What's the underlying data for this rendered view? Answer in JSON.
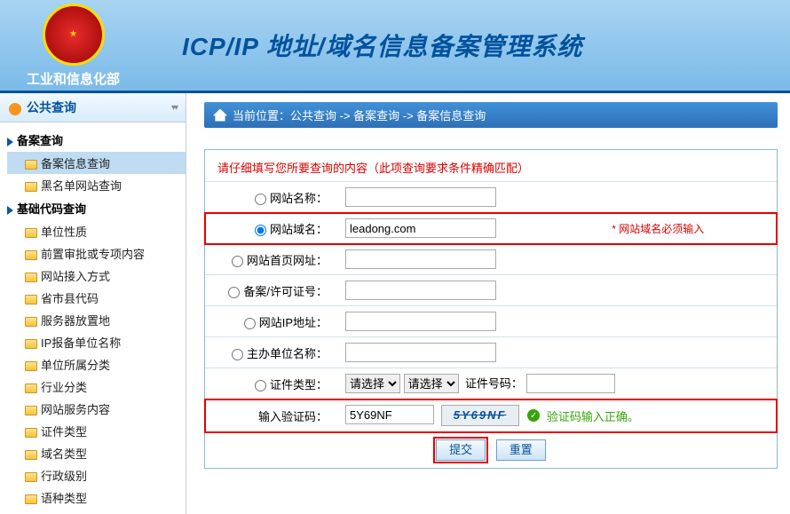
{
  "header": {
    "ministry": "工业和信息化部",
    "system_title": "ICP/IP 地址/域名信息备案管理系统"
  },
  "sidebar": {
    "header": "公共查询",
    "groups": [
      {
        "label": "备案查询",
        "items": [
          {
            "label": "备案信息查询",
            "selected": true
          },
          {
            "label": "黑名单网站查询",
            "selected": false
          }
        ]
      },
      {
        "label": "基础代码查询",
        "items": [
          {
            "label": "单位性质"
          },
          {
            "label": "前置审批或专项内容"
          },
          {
            "label": "网站接入方式"
          },
          {
            "label": "省市县代码"
          },
          {
            "label": "服务器放置地"
          },
          {
            "label": "IP报备单位名称"
          },
          {
            "label": "单位所属分类"
          },
          {
            "label": "行业分类"
          },
          {
            "label": "网站服务内容"
          },
          {
            "label": "证件类型"
          },
          {
            "label": "域名类型"
          },
          {
            "label": "行政级别"
          },
          {
            "label": "语种类型"
          }
        ]
      }
    ]
  },
  "breadcrumb": {
    "prefix": "当前位置：",
    "parts": [
      "公共查询",
      "备案查询",
      "备案信息查询"
    ],
    "sep": "->"
  },
  "form": {
    "hint": "请仔细填写您所要查询的内容（此项查询要求条件精确匹配）",
    "rows": {
      "site_name": {
        "label": "网站名称：",
        "value": ""
      },
      "site_domain": {
        "label": "网站域名：",
        "value": "leadong.com",
        "note": "* 网站域名必须输入"
      },
      "site_url": {
        "label": "网站首页网址：",
        "value": ""
      },
      "record_no": {
        "label": "备案/许可证号：",
        "value": ""
      },
      "site_ip": {
        "label": "网站IP地址：",
        "value": ""
      },
      "sponsor": {
        "label": "主办单位名称：",
        "value": ""
      },
      "cert": {
        "label": "证件类型：",
        "select1": "请选择",
        "select2": "请选择",
        "num_label": "证件号码：",
        "num_value": ""
      },
      "captcha": {
        "label": "输入验证码：",
        "value": "5Y69NF",
        "img_text": "5Y69NF",
        "ok_text": "验证码输入正确。"
      }
    },
    "buttons": {
      "submit": "提交",
      "reset": "重置"
    }
  }
}
